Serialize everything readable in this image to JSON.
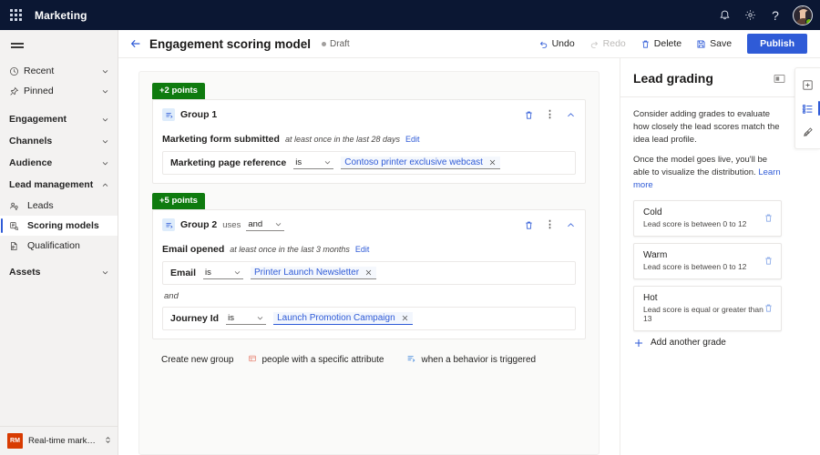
{
  "suite": {
    "title": "Marketing",
    "waffle_icon": "app-launcher-icon",
    "icons": [
      {
        "name": "notifications-icon",
        "label": "Notifications"
      },
      {
        "name": "settings-gear-icon",
        "label": "Settings"
      },
      {
        "name": "help-question-icon",
        "label": "Help"
      }
    ],
    "avatar": {
      "name": "user-avatar",
      "presence": "available"
    }
  },
  "sidebar": {
    "hamburger_label": "Show more",
    "quick": [
      {
        "label": "Recent",
        "icon": "clock-icon",
        "chevron": "chevron-down"
      },
      {
        "label": "Pinned",
        "icon": "pin-icon",
        "chevron": "chevron-down"
      }
    ],
    "groups": [
      {
        "label": "Engagement",
        "chevron": "chevron-down",
        "items": []
      },
      {
        "label": "Channels",
        "chevron": "chevron-down",
        "items": []
      },
      {
        "label": "Audience",
        "chevron": "chevron-down",
        "items": []
      },
      {
        "label": "Lead management",
        "chevron": "chevron-up",
        "items": [
          {
            "label": "Leads",
            "icon": "leads-icon",
            "selected": false
          },
          {
            "label": "Scoring models",
            "icon": "scoring-model-icon",
            "selected": true
          },
          {
            "label": "Qualification",
            "icon": "qualification-icon",
            "selected": false
          }
        ]
      },
      {
        "label": "Assets",
        "chevron": "chevron-down",
        "items": []
      }
    ],
    "environment": {
      "badge": "RM",
      "name": "Real-time marketi...",
      "chevron": "chevron-updown"
    }
  },
  "command_bar": {
    "back_icon": "back-arrow-icon",
    "title": "Engagement scoring model",
    "status": "Draft",
    "actions": [
      {
        "label": "Undo",
        "icon": "undo-icon",
        "disabled": false
      },
      {
        "label": "Redo",
        "icon": "redo-icon",
        "disabled": true
      },
      {
        "label": "Delete",
        "icon": "trash-icon",
        "disabled": false
      },
      {
        "label": "Save",
        "icon": "save-icon",
        "disabled": false
      }
    ],
    "publish_label": "Publish"
  },
  "canvas": {
    "groups": [
      {
        "points_badge": "+2 points",
        "name": "Group 1",
        "uses_label": "",
        "logic_operator": "",
        "has_logic": false,
        "trigger": {
          "name": "Marketing form submitted",
          "description": "at least once in the last 28 days",
          "edit_label": "Edit"
        },
        "conditions": [
          {
            "attribute": "Marketing page reference",
            "operator": "is",
            "value": "Contoso printer exclusive webcast",
            "active": false
          }
        ],
        "joiners": []
      },
      {
        "points_badge": "+5 points",
        "name": "Group 2",
        "uses_label": "uses",
        "logic_operator": "and",
        "has_logic": true,
        "trigger": {
          "name": "Email opened",
          "description": "at least once in the last 3 months",
          "edit_label": "Edit"
        },
        "conditions": [
          {
            "attribute": "Email",
            "operator": "is",
            "value": "Printer Launch Newsletter",
            "active": false
          },
          {
            "attribute": "Journey Id",
            "operator": "is",
            "value": "Launch Promotion Campaign",
            "active": true
          }
        ],
        "joiners": [
          "and"
        ]
      }
    ],
    "create_row": {
      "label": "Create new group",
      "options": [
        {
          "label": "people with a specific attribute",
          "icon": "attribute-group-icon"
        },
        {
          "label": "when a behavior is triggered",
          "icon": "behavior-trigger-icon"
        }
      ]
    }
  },
  "right_panel": {
    "title": "Lead grading",
    "collapse_icon": "collapse-panel-icon",
    "paragraphs": [
      "Consider adding grades to evaluate how closely the lead scores match the idea lead profile.",
      "Once the model goes live, you'll be able to visualize the distribution."
    ],
    "learn_more": "Learn more",
    "grades": [
      {
        "name": "Cold",
        "description": "Lead score is between 0 to 12"
      },
      {
        "name": "Warm",
        "description": "Lead score is between 0 to 12"
      },
      {
        "name": "Hot",
        "description": "Lead score is equal or greater than 13"
      }
    ],
    "add_grade_label": "Add another grade",
    "rail": [
      {
        "name": "add-panel-icon",
        "active": false
      },
      {
        "name": "lead-grading-list-icon",
        "active": true
      },
      {
        "name": "model-settings-icon",
        "active": false
      }
    ]
  },
  "colors": {
    "suite_bar": "#0b1733",
    "accent_blue": "#2f5bd7",
    "points_green": "#0f7b0f",
    "nav_bg": "#f3f2f1",
    "canvas_bg": "#fafaf9",
    "env_badge": "#d83b01",
    "presence_green": "#6bb700"
  }
}
